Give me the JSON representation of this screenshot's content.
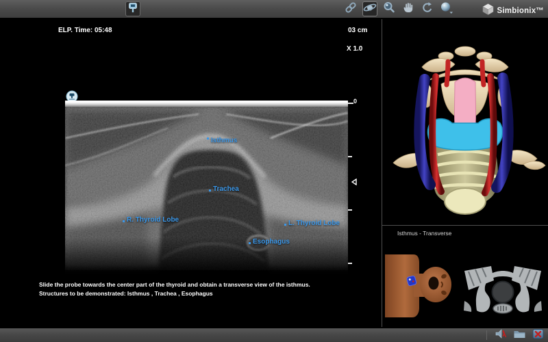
{
  "app": {
    "logo_text": "Simbionix™"
  },
  "hud": {
    "elapsed_time": "ELP. Time: 05:48",
    "depth": "03 cm",
    "zoom": "X 1.0",
    "ruler_zero": "0"
  },
  "ultrasound": {
    "anatomy_labels": [
      {
        "text": "Isthmus"
      },
      {
        "text": "Trachea"
      },
      {
        "text": "R. Thyroid Lobe"
      },
      {
        "text": "L. Thyroid Lobe"
      },
      {
        "text": "Esophagus"
      }
    ],
    "instructions": {
      "line1": "Slide the probe towards the center part of the thyroid and obtain a transverse view of the isthmus.",
      "line2": "Structures to be demonstrated: Isthmus , Trachea , Esophagus"
    }
  },
  "right_panel": {
    "view_label": "Isthmus - Transverse"
  },
  "icons": {
    "top_probe_button": "probe-select-icon",
    "toolbar": [
      "link-icon",
      "orbit-icon",
      "magnify-icon",
      "pan-icon",
      "rotate-icon",
      "render-sphere-icon"
    ],
    "logo": "simbionix-cube-icon",
    "ultrasound_marker": "probe-orientation-icon",
    "focus_marker": "focus-arrow-icon",
    "bottom_bar": [
      "speaker-icon",
      "folder-icon",
      "close-icon"
    ]
  },
  "colors": {
    "label_blue": "#3b97e8",
    "bar_gray": "#4a4a4a",
    "vein_blue": "#3a3ab8",
    "artery_red": "#c42020",
    "thyroid_cyan": "#3ec0ea",
    "bone_tan": "#e8d5ae",
    "trachea_olive": "#c4bf92",
    "esophagus_pink": "#f4aec4"
  }
}
